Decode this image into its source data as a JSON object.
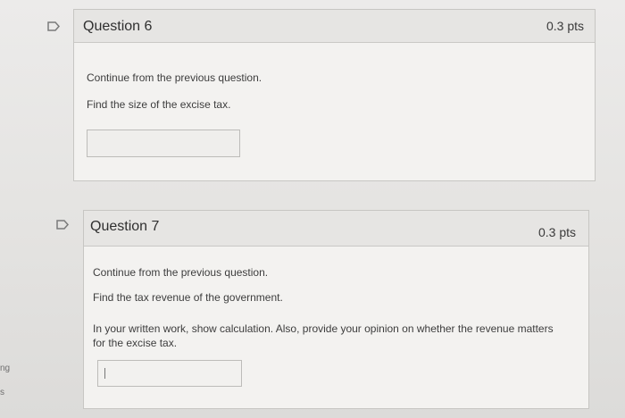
{
  "sidebar_edge": {
    "fragment_1": "ng",
    "fragment_2": "s"
  },
  "questions": [
    {
      "title": "Question 6",
      "points": "0.3 pts",
      "lines": [
        "Continue from the previous question.",
        "Find the size of the excise tax."
      ],
      "answer_value": ""
    },
    {
      "title": "Question 7",
      "points": "0.3 pts",
      "lines": [
        "Continue from the previous question.",
        "Find the tax revenue of the government.",
        "In your written work, show calculation. Also, provide your opinion on whether the revenue matters",
        "for the excise tax."
      ],
      "answer_value": ""
    }
  ],
  "icons": {
    "question_flag": "flag-outline-icon",
    "text_caret": "text-cursor"
  }
}
